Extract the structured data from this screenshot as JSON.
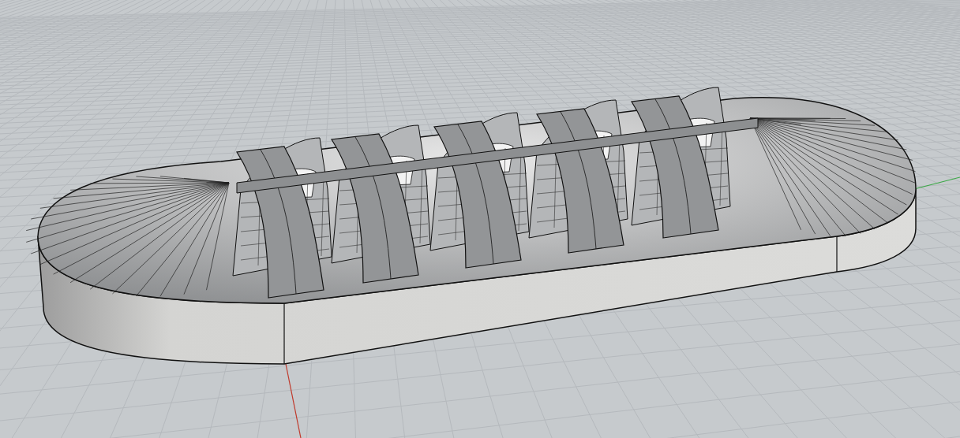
{
  "viewport": {
    "grid": true,
    "world_axes": true
  }
}
